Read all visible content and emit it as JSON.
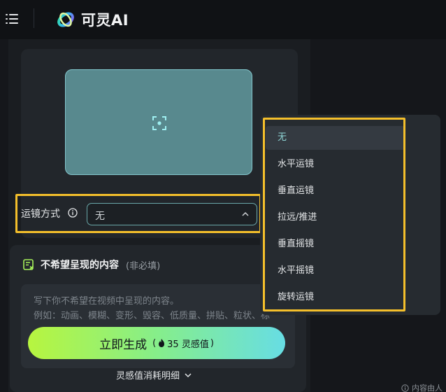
{
  "header": {
    "logo_text": "可灵AI",
    "icons": [
      "menu-icon",
      "kling-logo-icon"
    ]
  },
  "camera": {
    "label": "运镜方式",
    "selected_value": "无"
  },
  "negative_prompt": {
    "title": "不希望呈现的内容",
    "optional": "(非必填)",
    "placeholder_line1": "写下你不希望在视频中呈现的内容。",
    "placeholder_line2": "例如：动画、模糊、变形、毁容、低质量、拼贴、粒状、标"
  },
  "generate": {
    "label": "立即生成",
    "cost_open": "(",
    "cost_text": "35 灵感值",
    "cost_close": ")"
  },
  "cost_detail": {
    "label": "灵感值消耗明细"
  },
  "dropdown": {
    "options": [
      "无",
      "水平运镜",
      "垂直运镜",
      "拉远/推进",
      "垂直摇镜",
      "水平摇镜",
      "旋转运镜"
    ],
    "selected_index": 0
  },
  "footer": {
    "note": "内容由人"
  },
  "colors": {
    "background": "#15171b",
    "panel": "#22262b",
    "accent_teal": "#6aa7a9",
    "highlight": "#f4bf2b",
    "button_gradient_start": "#b7f53f",
    "button_gradient_end": "#67dde4"
  }
}
